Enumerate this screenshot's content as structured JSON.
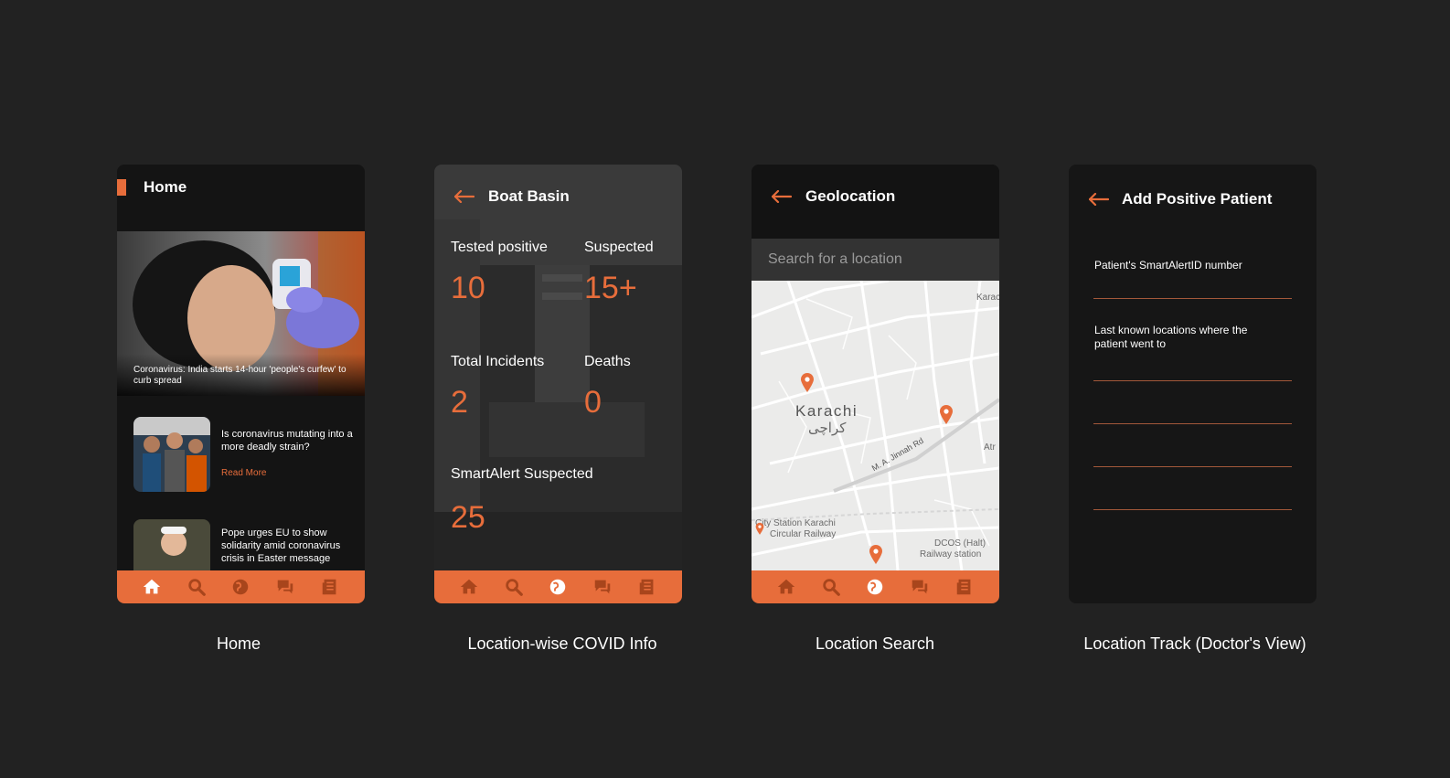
{
  "colors": {
    "accent": "#e76d3b",
    "background": "#222222",
    "screen": "#141414"
  },
  "bottom_nav": {
    "items": [
      {
        "icon": "home-icon"
      },
      {
        "icon": "search-icon"
      },
      {
        "icon": "globe-icon"
      },
      {
        "icon": "chat-icon"
      },
      {
        "icon": "news-icon"
      }
    ]
  },
  "home": {
    "title": "Home",
    "hero_caption": "Coronavirus: India starts 14-hour 'people's curfew' to curb spread",
    "articles": [
      {
        "headline": "Is coronavirus mutating into a more deadly strain?",
        "read_more": "Read More"
      },
      {
        "headline": "Pope urges EU to show solidarity amid coronavirus crisis in Easter message"
      }
    ],
    "caption": "Home"
  },
  "location_info": {
    "title": "Boat Basin",
    "stats": {
      "tested_positive_label": "Tested positive",
      "tested_positive_value": "10",
      "suspected_label": "Suspected",
      "suspected_value": "15+",
      "total_incidents_label": "Total Incidents",
      "total_incidents_value": "2",
      "deaths_label": "Deaths",
      "deaths_value": "0",
      "smartalert_label": "SmartAlert Suspected",
      "smartalert_value": "25"
    },
    "caption": "Location-wise COVID Info"
  },
  "location_search": {
    "title": "Geolocation",
    "search_placeholder": "Search for a location",
    "map": {
      "city": "Karachi",
      "city_urdu": "کراچی",
      "road": "M. A. Jinnah Rd",
      "station_1": "City Station Karachi",
      "station_1b": "Circular Railway",
      "station_2": "DCOS (Halt)",
      "station_2b": "Railway station",
      "edge_1": "Karac",
      "edge_2": "Atr"
    },
    "caption": "Location Search"
  },
  "add_patient": {
    "title": "Add Positive Patient",
    "field_id_label": "Patient's SmartAlertID number",
    "field_locations_label": "Last known locations where the patient went to",
    "caption": "Location Track (Doctor's View)"
  }
}
